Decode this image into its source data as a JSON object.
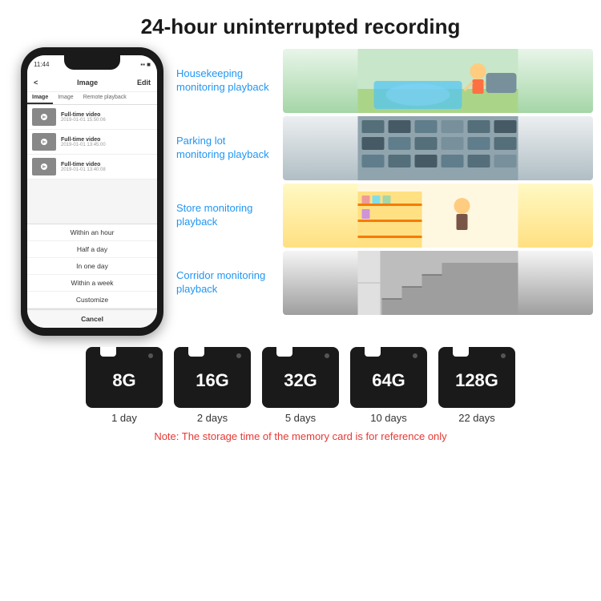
{
  "header": {
    "title": "24-hour uninterrupted recording"
  },
  "phone": {
    "status_time": "11:44",
    "nav_back": "<",
    "nav_title": "Image",
    "nav_edit": "Edit",
    "tabs": [
      "Image",
      "Image",
      "Remote playback"
    ],
    "list_items": [
      {
        "title": "Full-time video",
        "date": "2019-01-01 15:50:06"
      },
      {
        "title": "Full-time video",
        "date": "2019-01-01 13:45:00"
      },
      {
        "title": "Full-time video",
        "date": "2019-01-01 13:40:08"
      }
    ],
    "dropdown_items": [
      "Within an hour",
      "Half a day",
      "In one day",
      "Within a week",
      "Customize"
    ],
    "cancel_label": "Cancel"
  },
  "monitoring": [
    {
      "label": "Housekeeping monitoring playback",
      "bg": "housekeeping"
    },
    {
      "label": "Parking lot monitoring playback",
      "bg": "parking"
    },
    {
      "label": "Store monitoring playback",
      "bg": "store"
    },
    {
      "label": "Corridor monitoring playback",
      "bg": "corridor"
    }
  ],
  "sd_cards": [
    {
      "size": "8G",
      "days": "1 day"
    },
    {
      "size": "16G",
      "days": "2 days"
    },
    {
      "size": "32G",
      "days": "5 days"
    },
    {
      "size": "64G",
      "days": "10 days"
    },
    {
      "size": "128G",
      "days": "22 days"
    }
  ],
  "note": "Note: The storage time of the memory card is for reference only"
}
